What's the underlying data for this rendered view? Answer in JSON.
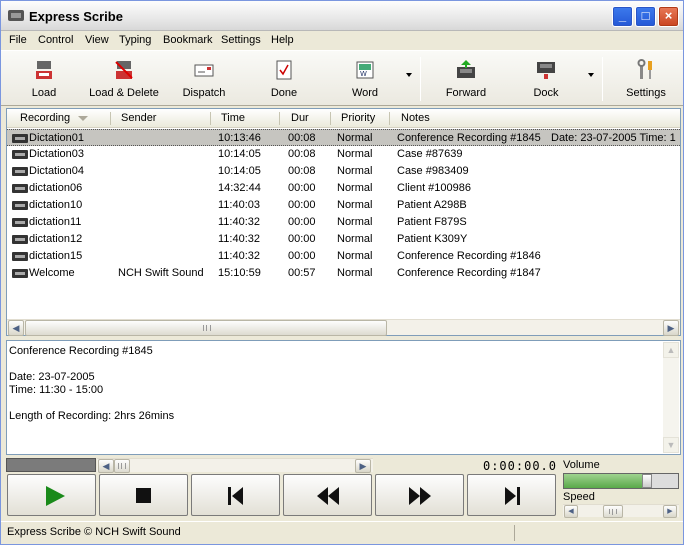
{
  "window": {
    "title": "Express Scribe"
  },
  "menu": [
    "File",
    "Control",
    "View",
    "Typing",
    "Bookmark",
    "Settings",
    "Help"
  ],
  "toolbar": {
    "load": "Load",
    "load_delete": "Load & Delete",
    "dispatch": "Dispatch",
    "done": "Done",
    "word": "Word",
    "forward": "Forward",
    "dock": "Dock",
    "settings": "Settings"
  },
  "list": {
    "columns": [
      "Recording",
      "Sender",
      "Time",
      "Dur",
      "Priority",
      "Notes"
    ],
    "rows": [
      {
        "recording": "Dictation01",
        "sender": "",
        "time": "10:13:46",
        "dur": "00:08",
        "priority": "Normal",
        "notes": "Conference Recording #1845",
        "notes_extra": "Date: 23-07-2005   Time: 1"
      },
      {
        "recording": "Dictation03",
        "sender": "",
        "time": "10:14:05",
        "dur": "00:08",
        "priority": "Normal",
        "notes": "Case #87639",
        "notes_extra": ""
      },
      {
        "recording": "Dictation04",
        "sender": "",
        "time": "10:14:05",
        "dur": "00:08",
        "priority": "Normal",
        "notes": "Case #983409",
        "notes_extra": ""
      },
      {
        "recording": "dictation06",
        "sender": "",
        "time": "14:32:44",
        "dur": "00:00",
        "priority": "Normal",
        "notes": "Client #100986",
        "notes_extra": ""
      },
      {
        "recording": "dictation10",
        "sender": "",
        "time": "11:40:03",
        "dur": "00:00",
        "priority": "Normal",
        "notes": "Patient A298B",
        "notes_extra": ""
      },
      {
        "recording": "dictation11",
        "sender": "",
        "time": "11:40:32",
        "dur": "00:00",
        "priority": "Normal",
        "notes": "Patient F879S",
        "notes_extra": ""
      },
      {
        "recording": "dictation12",
        "sender": "",
        "time": "11:40:32",
        "dur": "00:00",
        "priority": "Normal",
        "notes": "Patient K309Y",
        "notes_extra": ""
      },
      {
        "recording": "dictation15",
        "sender": "",
        "time": "11:40:32",
        "dur": "00:00",
        "priority": "Normal",
        "notes": "Conference Recording #1846",
        "notes_extra": ""
      },
      {
        "recording": "Welcome",
        "sender": "NCH Swift Sound",
        "time": "15:10:59",
        "dur": "00:57",
        "priority": "Normal",
        "notes": "Conference Recording #1847",
        "notes_extra": ""
      }
    ]
  },
  "notes_panel": {
    "text": "Conference Recording #1845\n\nDate: 23-07-2005\nTime: 11:30 - 15:00\n\nLength of Recording: 2hrs 26mins"
  },
  "transport": {
    "time": "0:00:00.0",
    "volume_label": "Volume",
    "speed_label": "Speed",
    "volume_level": 0.73
  },
  "status": {
    "text": "Express Scribe © NCH Swift Sound"
  },
  "colors": {
    "play_green": "#1a8a1a",
    "volume_green": "#5aa94a"
  }
}
